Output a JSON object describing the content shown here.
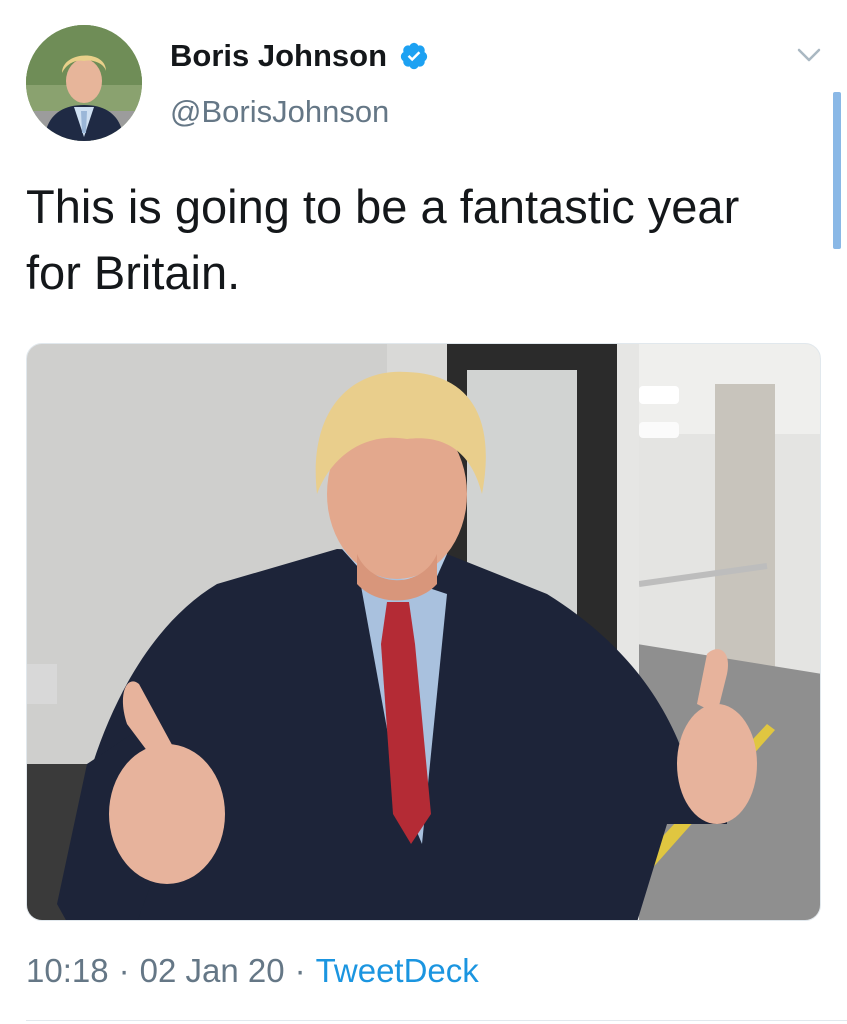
{
  "tweet": {
    "author": {
      "display_name": "Boris Johnson",
      "handle": "@BorisJohnson",
      "verified": true,
      "avatar": "profile-photo"
    },
    "text": "This is going to be a fantastic year for Britain.",
    "media": {
      "type": "photo",
      "subject": "man-giving-two-thumbs-up"
    },
    "time": "10:18",
    "separator": "·",
    "date": "02 Jan 20",
    "source": "TweetDeck"
  },
  "colors": {
    "text_primary": "#14171a",
    "text_secondary": "#657786",
    "link": "#1b95e0",
    "verified_badge": "#1da1f2",
    "scroll_indicator": "#8ab8e6"
  },
  "icons": {
    "verified": "verified-badge-icon",
    "caret": "chevron-down-icon"
  }
}
